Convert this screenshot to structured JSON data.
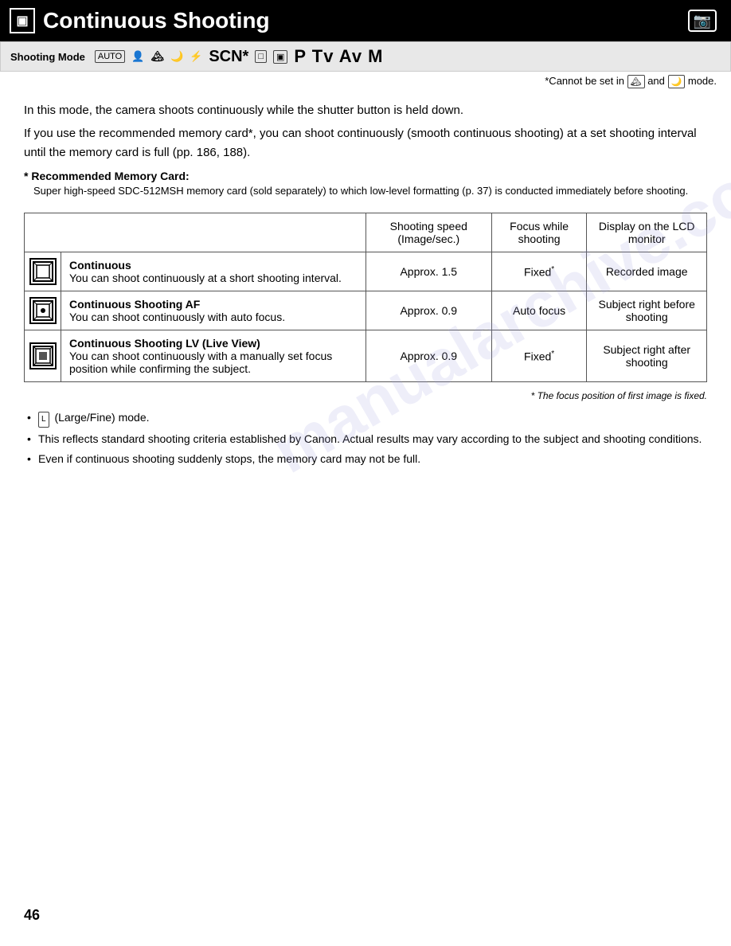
{
  "header": {
    "icon_label": "▣",
    "title": "Continuous Shooting",
    "camera_icon": "📷"
  },
  "shooting_mode_bar": {
    "label": "Shooting Mode",
    "modes_text": "P Tv Av M",
    "scn_text": "SCN*"
  },
  "cannot_set": {
    "text": "*Cannot be set in",
    "and_text": "and",
    "mode_text": "mode."
  },
  "intro": {
    "line1": "In this mode, the camera shoots continuously while the shutter button is held down.",
    "line2": "If you use the recommended memory card*, you can shoot continuously (smooth continuous shooting) at a set shooting interval until the memory card is full (pp. 186, 188)."
  },
  "recommended": {
    "title": "* Recommended Memory Card:",
    "body": "Super high-speed SDC-512MSH memory card (sold separately) to which low-level formatting (p. 37) is conducted immediately before shooting."
  },
  "table": {
    "headers": [
      "Shooting speed (Image/sec.)",
      "Focus while shooting",
      "Display on the LCD monitor"
    ],
    "rows": [
      {
        "icon": "▣",
        "name": "Continuous",
        "desc": "You can shoot continuously at a short shooting interval.",
        "speed": "Approx. 1.5",
        "focus": "Fixed*",
        "display": "Recorded image"
      },
      {
        "icon": "▣",
        "name": "Continuous Shooting AF",
        "desc": "You can shoot continuously with auto focus.",
        "speed": "Approx. 0.9",
        "focus": "Auto focus",
        "display": "Subject right before shooting"
      },
      {
        "icon": "▣",
        "name": "Continuous Shooting LV (Live View)",
        "desc": "You can shoot continuously with a manually set focus position while confirming the subject.",
        "speed": "Approx. 0.9",
        "focus": "Fixed*",
        "display": "Subject right after shooting"
      }
    ],
    "footnote": "* The focus position of first image is fixed."
  },
  "bullets": [
    "(Large/Fine) mode.",
    "This reflects standard shooting criteria established by Canon. Actual results may vary according to the subject and shooting conditions.",
    "Even if continuous shooting suddenly stops, the memory card may not be full."
  ],
  "page_number": "46",
  "watermark": "manualarchive.com"
}
